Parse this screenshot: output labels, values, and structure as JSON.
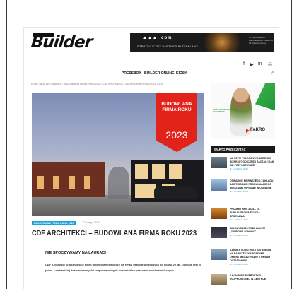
{
  "header": {
    "logo_text": "Builder",
    "banner": {
      "brand": "▲▲▲ .com",
      "subtitle": "STRATEGICZNY PARTNER BUDOWLANY",
      "info": "Ul. Ogrodowa 58 Warszawa +48 22 000 00 00 www.tlm.com.pl"
    },
    "social_icons": [
      "facebook-icon",
      "youtube-icon",
      "linkedin-icon",
      "instagram-icon"
    ],
    "social_glyphs": [
      "f",
      "▶",
      "in",
      "◎"
    ]
  },
  "nav": {
    "items": [
      "PRESSBOX",
      "BUILDER ONLINE",
      "KIOSK"
    ],
    "search_glyph": "⌕"
  },
  "breadcrumb": "HOME  ›  BUILDER AWARDS  ›  BUDOWLANA FIRMA ROKU 2023  ›  CDF ARCHITEKCI – BUDOWLANA FIRMA ROKU 2023",
  "article": {
    "award": {
      "title": "BUDOWLANA FIRMA ROKU",
      "year": "2023",
      "color": "#e2231a"
    },
    "category_tag": "BUDOWLANA FIRMA ROKU 2023",
    "date": "17 lutego 2024",
    "title": "CDF ARCHITEKCI – BUDOWLANA FIRMA ROKU 2023",
    "subheading": "NIE SPOCZYWAMY NA LAURACH",
    "lead": "CDF Architekci to poznańskie biuro projektowe istniejące na rynku usług projektowych od ponad 20 lat. Obecnie jest to jedno z najbardziej doświadczonych i rozpoznawalnych poznańskich pracowni architektonicznych."
  },
  "sidebar": {
    "ad": {
      "text": "NOWA GENERACJA OKIEN DACHOWYCH",
      "brand": "FAKRO"
    },
    "heading": "WARTO PRZECZYTAĆ",
    "items": [
      {
        "title": "NA CZYM POLEGA WYDOBRZENIE BIZNESU? OD CZEGO ZACZĄĆ I JAK SIĘ PRZYGOTOWAĆ?",
        "meta": "⊕ 1 LUTEGO 2024"
      },
      {
        "title": "OTWARCIE PIERWSZEGO ZAKŁADU SAINT-GOBAIN PRODUKUJĄCEGO MIESZANKI GIPSOWE W UKRAINIE",
        "meta": "⊕ 1 LUTEGO 2024"
      },
      {
        "title": "PROJEKT RMS 2024 – 15. JUBILEUSZOWA EDYCJA SPOTKANIA!",
        "meta": "⊕ 1 LUTEGO 2024"
      },
      {
        "title": "BIM DAYS 2024 POD HASŁEM „ZYFROWE SCHODY”",
        "meta": "⊕ 1 LUTEGO 2024"
      },
      {
        "title": "KARDEX CONSTRUCTION BUDUJE NA NAJWYŻSZYM POZIOMIE – ORIENT MAGAZYNOWY Z DREAM OUTSTANDING",
        "meta": "⊕ 1 LUTEGO 2024"
      },
      {
        "title": "II KONGRES ENERGETYKI ROZPROSZONEJ W CENTRUM",
        "meta": ""
      }
    ]
  },
  "colors": {
    "accent": "#19a4dc",
    "award_red": "#e2231a",
    "dark": "#1a1a1a"
  }
}
